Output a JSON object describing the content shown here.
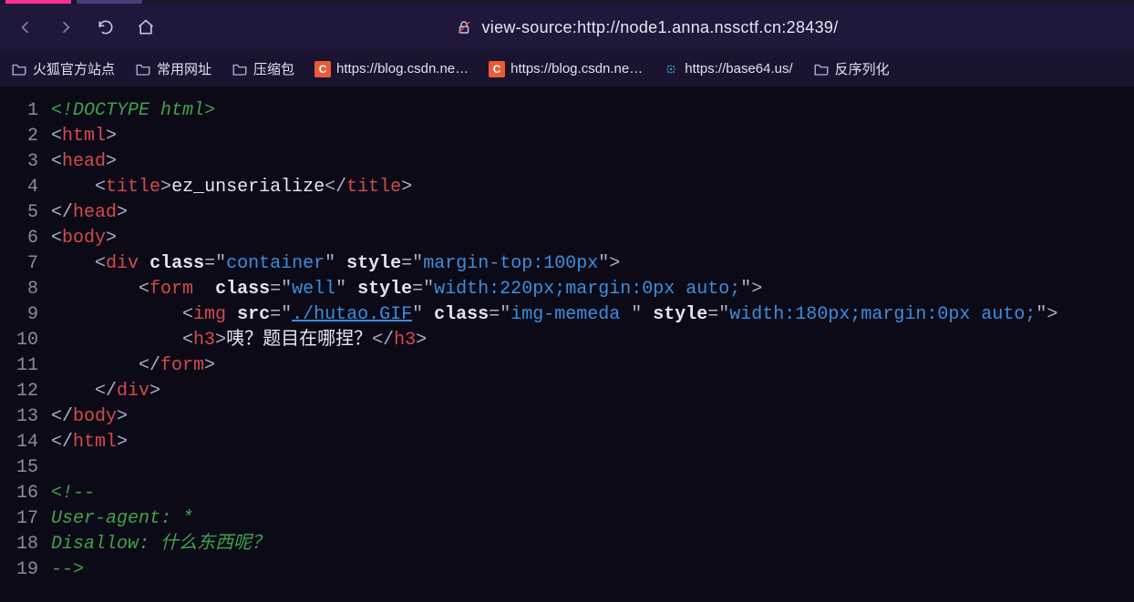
{
  "address": "view-source:http://node1.anna.nssctf.cn:28439/",
  "bookmarks": [
    {
      "kind": "folder",
      "label": "火狐官方站点"
    },
    {
      "kind": "folder",
      "label": "常用网址"
    },
    {
      "kind": "folder",
      "label": "压缩包"
    },
    {
      "kind": "c",
      "label": "https://blog.csdn.ne…"
    },
    {
      "kind": "c",
      "label": "https://blog.csdn.ne…"
    },
    {
      "kind": "blob",
      "label": "https://base64.us/"
    },
    {
      "kind": "folder",
      "label": "反序列化"
    }
  ],
  "ln": {
    "1": "1",
    "2": "2",
    "3": "3",
    "4": "4",
    "5": "5",
    "6": "6",
    "7": "7",
    "8": "8",
    "9": "9",
    "10": "10",
    "11": "11",
    "12": "12",
    "13": "13",
    "14": "14",
    "15": "15",
    "16": "16",
    "17": "17",
    "18": "18",
    "19": "19"
  },
  "src": {
    "doc": "<!DOCTYPE html>",
    "tag_html": "html",
    "tag_head": "head",
    "tag_title": "title",
    "title_text": "ez_unserialize",
    "tag_body": "body",
    "tag_div": "div",
    "attr_class": "class",
    "attr_style": "style",
    "attr_src": "src",
    "div_class": "container",
    "div_style": "margin-top:100px",
    "tag_form": "form",
    "form_class": "well",
    "form_style": "width:220px;margin:0px auto;",
    "tag_img": "img",
    "img_src": "./hutao.GIF",
    "img_class": "img-memeda ",
    "img_style": "width:180px;margin:0px auto;",
    "tag_h3": "h3",
    "h3_text": "咦？题目在哪捏？",
    "c_open": "<!--",
    "c_line1": "User-agent: *",
    "c_line2": "Disallow: 什么东西呢？",
    "c_close": "-->"
  }
}
